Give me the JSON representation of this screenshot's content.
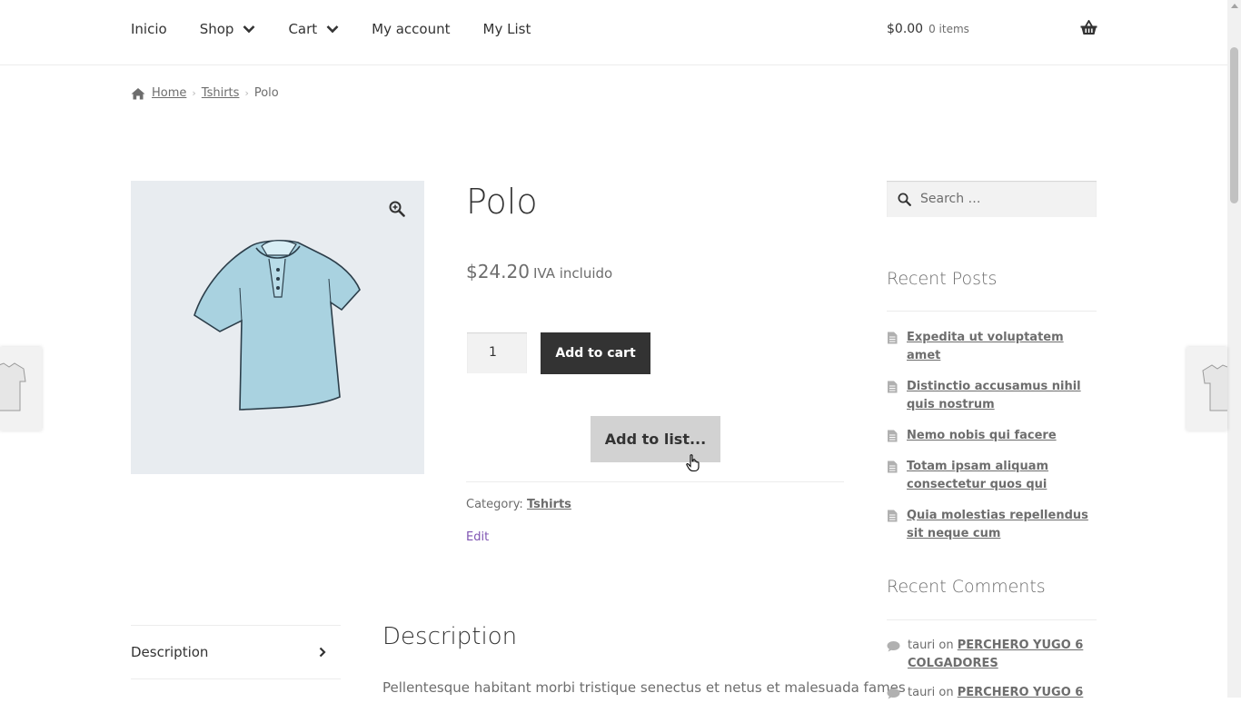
{
  "nav": {
    "items": [
      {
        "label": "Inicio"
      },
      {
        "label": "Shop"
      },
      {
        "label": "Cart"
      },
      {
        "label": "My account"
      },
      {
        "label": "My List"
      }
    ]
  },
  "mini_cart": {
    "amount": "$0.00",
    "items": "0 items"
  },
  "breadcrumb": {
    "home": "Home",
    "category": "Tshirts",
    "current": "Polo"
  },
  "product": {
    "title": "Polo",
    "price": "$24.20",
    "tax_note": "IVA incluido",
    "quantity": "1",
    "add_to_cart": "Add to cart",
    "add_to_list": "Add to list...",
    "category_label": "Category:",
    "category": "Tshirts",
    "edit": "Edit"
  },
  "tabs": {
    "description": "Description"
  },
  "description": {
    "title": "Description",
    "text": "Pellentesque habitant morbi tristique senectus et netus et malesuada fames"
  },
  "sidebar": {
    "search_placeholder": "Search …",
    "recent_posts_title": "Recent Posts",
    "posts": [
      "Expedita ut voluptatem amet",
      "Distinctio accusamus nihil quis nostrum",
      "Nemo nobis qui facere",
      "Totam ipsam aliquam consectetur quos qui",
      "Quia molestias repellendus sit neque cum"
    ],
    "recent_comments_title": "Recent Comments",
    "comments": [
      {
        "author": "tauri",
        "on": "on",
        "post": "PERCHERO YUGO 6 COLGADORES"
      },
      {
        "author": "tauri",
        "on": "on",
        "post": "PERCHERO YUGO 6"
      }
    ]
  },
  "colors": {
    "accent": "#333333",
    "link_purple": "#7f54b3",
    "image_bg": "#e8ecf0"
  }
}
